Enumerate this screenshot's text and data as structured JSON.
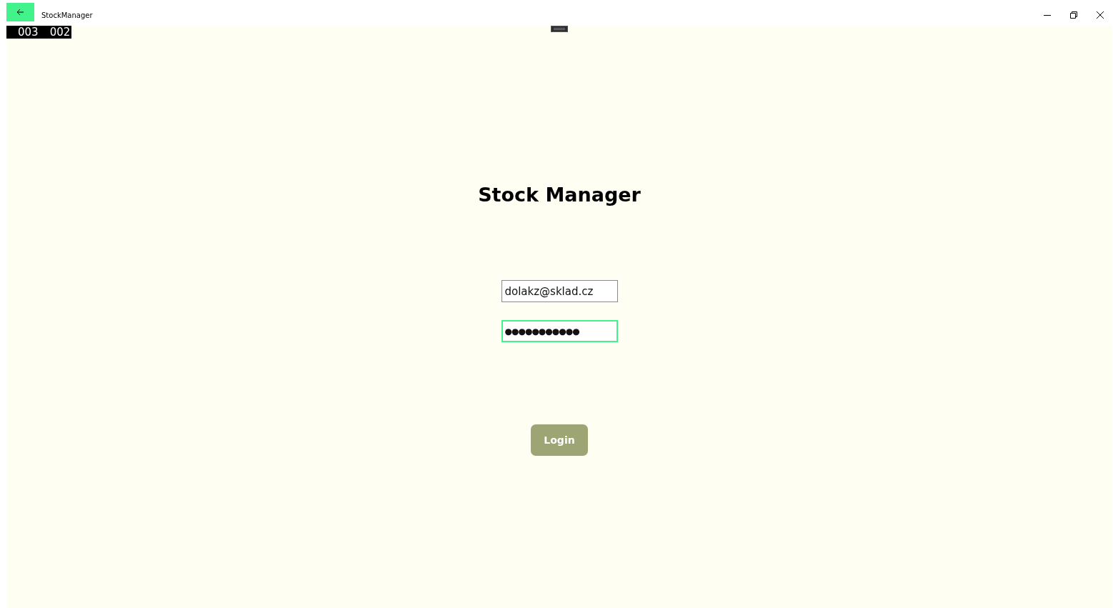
{
  "window": {
    "title": "StockManager"
  },
  "frame_counters": [
    "003",
    "002"
  ],
  "heading": "Stock Manager",
  "fields": [
    {
      "kind": "email",
      "value": "dolakz@sklad.cz",
      "focused": false
    },
    {
      "kind": "password",
      "value": "●●●●●●●●●●●",
      "focused": true
    }
  ],
  "login_button": {
    "label": "Login"
  }
}
